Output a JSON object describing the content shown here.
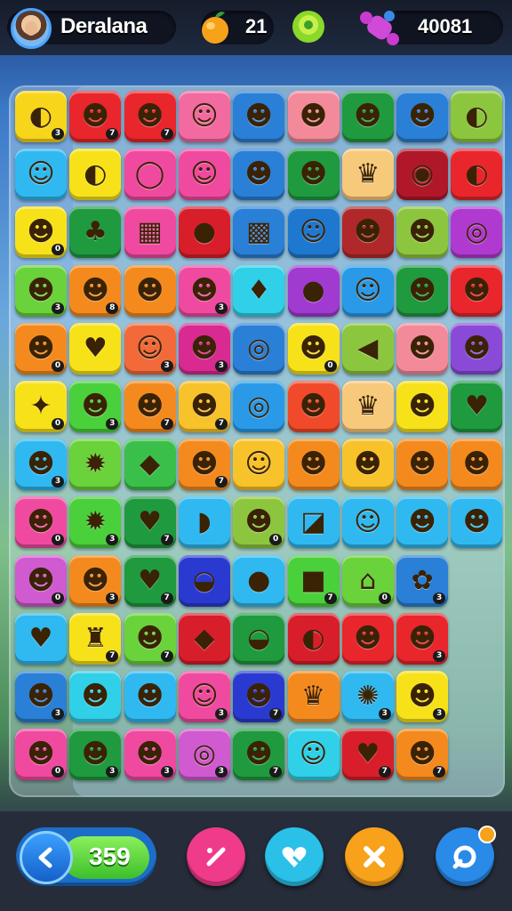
{
  "header": {
    "player_name": "Deralana",
    "coins": "21",
    "score": "40081"
  },
  "footer": {
    "moves": "359"
  },
  "board": {
    "tiles": [
      {
        "bg": "#f7d51a",
        "glyph": "◐",
        "badge": "3"
      },
      {
        "bg": "#e8262c",
        "glyph": "☻",
        "badge": "7"
      },
      {
        "bg": "#e8262c",
        "glyph": "☻",
        "badge": "7"
      },
      {
        "bg": "#f26aa0",
        "glyph": "☺",
        "badge": ""
      },
      {
        "bg": "#2a7fd6",
        "glyph": "☻",
        "badge": ""
      },
      {
        "bg": "#f38a9a",
        "glyph": "☻",
        "badge": ""
      },
      {
        "bg": "#1f9a3e",
        "glyph": "☻",
        "badge": ""
      },
      {
        "bg": "#2a7fd6",
        "glyph": "☻",
        "badge": ""
      },
      {
        "bg": "#8cc63e",
        "glyph": "◐",
        "badge": ""
      },
      {
        "bg": "#2fb9f0",
        "glyph": "☺",
        "badge": ""
      },
      {
        "bg": "#f7e21a",
        "glyph": "◐",
        "badge": ""
      },
      {
        "bg": "#f04aa0",
        "glyph": "◯",
        "badge": ""
      },
      {
        "bg": "#f04aa0",
        "glyph": "☺",
        "badge": ""
      },
      {
        "bg": "#2a7fd6",
        "glyph": "☻",
        "badge": ""
      },
      {
        "bg": "#1f9a3e",
        "glyph": "☻",
        "badge": ""
      },
      {
        "bg": "#f7c97a",
        "glyph": "♛",
        "badge": ""
      },
      {
        "bg": "#b0182a",
        "glyph": "◉",
        "badge": ""
      },
      {
        "bg": "#e8262c",
        "glyph": "◐",
        "badge": ""
      },
      {
        "bg": "#f7e21a",
        "glyph": "☻",
        "badge": "0"
      },
      {
        "bg": "#1f9a3e",
        "glyph": "♣",
        "badge": ""
      },
      {
        "bg": "#f04aa0",
        "glyph": "▦",
        "badge": ""
      },
      {
        "bg": "#d81e2a",
        "glyph": "●",
        "badge": ""
      },
      {
        "bg": "#2a7fd6",
        "glyph": "▩",
        "badge": ""
      },
      {
        "bg": "#1e78d0",
        "glyph": "☺",
        "badge": ""
      },
      {
        "bg": "#b0282a",
        "glyph": "☻",
        "badge": ""
      },
      {
        "bg": "#8cc63e",
        "glyph": "☻",
        "badge": ""
      },
      {
        "bg": "#b03ad0",
        "glyph": "◎",
        "badge": ""
      },
      {
        "bg": "#6ad23a",
        "glyph": "☻",
        "badge": "3"
      },
      {
        "bg": "#f48a1e",
        "glyph": "☻",
        "badge": "8"
      },
      {
        "bg": "#f48a1e",
        "glyph": "☻",
        "badge": ""
      },
      {
        "bg": "#f04aa0",
        "glyph": "☻",
        "badge": "3"
      },
      {
        "bg": "#2fd0e8",
        "glyph": "♦",
        "badge": ""
      },
      {
        "bg": "#a03ad0",
        "glyph": "●",
        "badge": ""
      },
      {
        "bg": "#2a9ae8",
        "glyph": "☺",
        "badge": ""
      },
      {
        "bg": "#1f9a3e",
        "glyph": "☻",
        "badge": ""
      },
      {
        "bg": "#e8262c",
        "glyph": "☻",
        "badge": ""
      },
      {
        "bg": "#f48a1e",
        "glyph": "☻",
        "badge": "0"
      },
      {
        "bg": "#f7e21a",
        "glyph": "♥",
        "badge": ""
      },
      {
        "bg": "#f26a3a",
        "glyph": "☺",
        "badge": "3"
      },
      {
        "bg": "#d82a90",
        "glyph": "☻",
        "badge": "3"
      },
      {
        "bg": "#2a7fd6",
        "glyph": "◎",
        "badge": ""
      },
      {
        "bg": "#f7e21a",
        "glyph": "☻",
        "badge": "0"
      },
      {
        "bg": "#8cc63e",
        "glyph": "◀",
        "badge": ""
      },
      {
        "bg": "#f38a9a",
        "glyph": "☻",
        "badge": ""
      },
      {
        "bg": "#8a4ad8",
        "glyph": "☻",
        "badge": ""
      },
      {
        "bg": "#f7e21a",
        "glyph": "✦",
        "badge": "0"
      },
      {
        "bg": "#4ad03a",
        "glyph": "☻",
        "badge": "3"
      },
      {
        "bg": "#f48a1e",
        "glyph": "☻",
        "badge": "7"
      },
      {
        "bg": "#f7c22a",
        "glyph": "☻",
        "badge": "7"
      },
      {
        "bg": "#2a9ae8",
        "glyph": "◎",
        "badge": ""
      },
      {
        "bg": "#f04a2a",
        "glyph": "☻",
        "badge": ""
      },
      {
        "bg": "#f7c97a",
        "glyph": "♛",
        "badge": ""
      },
      {
        "bg": "#f7e21a",
        "glyph": "☻",
        "badge": ""
      },
      {
        "bg": "#1f9a3e",
        "glyph": "♥",
        "badge": ""
      },
      {
        "bg": "#2fb9f0",
        "glyph": "☻",
        "badge": "3"
      },
      {
        "bg": "#6ad23a",
        "glyph": "✹",
        "badge": ""
      },
      {
        "bg": "#3ac04a",
        "glyph": "◆",
        "badge": ""
      },
      {
        "bg": "#f48a1e",
        "glyph": "☻",
        "badge": "7"
      },
      {
        "bg": "#f7c22a",
        "glyph": "☺",
        "badge": ""
      },
      {
        "bg": "#f48a1e",
        "glyph": "☻",
        "badge": ""
      },
      {
        "bg": "#f7c22a",
        "glyph": "☻",
        "badge": ""
      },
      {
        "bg": "#f48a1e",
        "glyph": "☻",
        "badge": ""
      },
      {
        "bg": "#f48a1e",
        "glyph": "☻",
        "badge": ""
      },
      {
        "bg": "#f04aa0",
        "glyph": "☻",
        "badge": "0"
      },
      {
        "bg": "#4ad03a",
        "glyph": "✹",
        "badge": "3"
      },
      {
        "bg": "#1f9a3e",
        "glyph": "♥",
        "badge": "7"
      },
      {
        "bg": "#2fb9f0",
        "glyph": "◗",
        "badge": ""
      },
      {
        "bg": "#8cc63e",
        "glyph": "☻",
        "badge": "0"
      },
      {
        "bg": "#2fb9f0",
        "glyph": "◪",
        "badge": ""
      },
      {
        "bg": "#2fb9f0",
        "glyph": "☺",
        "badge": ""
      },
      {
        "bg": "#2fb9f0",
        "glyph": "☻",
        "badge": ""
      },
      {
        "bg": "#2fb9f0",
        "glyph": "☻",
        "badge": ""
      },
      {
        "bg": "#d05ad0",
        "glyph": "☻",
        "badge": "0"
      },
      {
        "bg": "#f48a1e",
        "glyph": "☻",
        "badge": "3"
      },
      {
        "bg": "#1f9a3e",
        "glyph": "♥",
        "badge": "7"
      },
      {
        "bg": "#2a3ad0",
        "glyph": "◒",
        "badge": ""
      },
      {
        "bg": "#2fb9f0",
        "glyph": "●",
        "badge": ""
      },
      {
        "bg": "#4ad03a",
        "glyph": "■",
        "badge": "7"
      },
      {
        "bg": "#6ad23a",
        "glyph": "⌂",
        "badge": "0"
      },
      {
        "bg": "#2a7fd6",
        "glyph": "✿",
        "badge": "3"
      },
      {
        "bg": "#2fb9f0",
        "glyph": "",
        "badge": ""
      },
      {
        "bg": "#2fb9f0",
        "glyph": "♥",
        "badge": ""
      },
      {
        "bg": "#f7e21a",
        "glyph": "♜",
        "badge": "7"
      },
      {
        "bg": "#6ad23a",
        "glyph": "☻",
        "badge": "7"
      },
      {
        "bg": "#d81e2a",
        "glyph": "◆",
        "badge": ""
      },
      {
        "bg": "#1f9a3e",
        "glyph": "◒",
        "badge": ""
      },
      {
        "bg": "#d81e2a",
        "glyph": "◐",
        "badge": ""
      },
      {
        "bg": "#e8262c",
        "glyph": "☻",
        "badge": ""
      },
      {
        "bg": "#e8262c",
        "glyph": "☻",
        "badge": "3"
      },
      {
        "bg": "#2fb9f0",
        "glyph": "",
        "badge": ""
      },
      {
        "bg": "#2a7fd6",
        "glyph": "☻",
        "badge": "3"
      },
      {
        "bg": "#2fd0e8",
        "glyph": "☻",
        "badge": ""
      },
      {
        "bg": "#2fb9f0",
        "glyph": "☻",
        "badge": ""
      },
      {
        "bg": "#f04aa0",
        "glyph": "☺",
        "badge": "3"
      },
      {
        "bg": "#2a3ad0",
        "glyph": "☻",
        "badge": "7"
      },
      {
        "bg": "#f48a1e",
        "glyph": "♛",
        "badge": ""
      },
      {
        "bg": "#2fb9f0",
        "glyph": "✺",
        "badge": "3"
      },
      {
        "bg": "#f7e21a",
        "glyph": "☻",
        "badge": "3"
      },
      {
        "bg": "#2fb9f0",
        "glyph": "",
        "badge": ""
      },
      {
        "bg": "#f04aa0",
        "glyph": "☻",
        "badge": "0"
      },
      {
        "bg": "#1f9a3e",
        "glyph": "☻",
        "badge": "3"
      },
      {
        "bg": "#f04aa0",
        "glyph": "☻",
        "badge": "3"
      },
      {
        "bg": "#d05ad0",
        "glyph": "◎",
        "badge": "3"
      },
      {
        "bg": "#1f9a3e",
        "glyph": "☻",
        "badge": "7"
      },
      {
        "bg": "#2fd0e8",
        "glyph": "☺",
        "badge": ""
      },
      {
        "bg": "#d81e2a",
        "glyph": "♥",
        "badge": "7"
      },
      {
        "bg": "#f48a1e",
        "glyph": "☻",
        "badge": "7"
      },
      {
        "bg": "#2fb9f0",
        "glyph": "",
        "badge": ""
      }
    ]
  },
  "colors": {
    "pink_button": "#f03a8a",
    "cyan_button": "#2ac0e8",
    "orange_button": "#f7a21a",
    "blue_button": "#2a8ae8"
  }
}
